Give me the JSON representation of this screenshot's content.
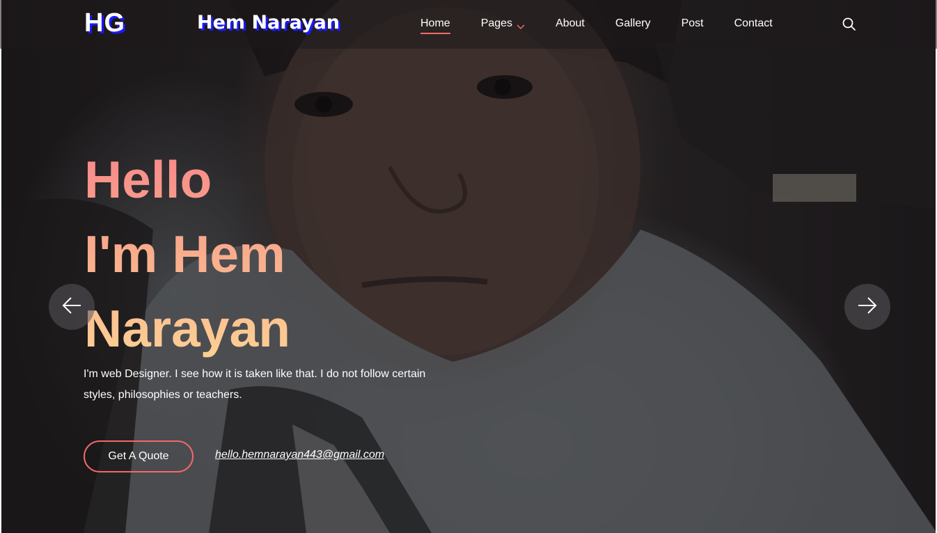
{
  "header": {
    "logo": "HG",
    "brand_name": "Hem Narayan",
    "nav": [
      {
        "label": "Home",
        "active": true
      },
      {
        "label": "Pages",
        "has_dropdown": true
      },
      {
        "label": "About"
      },
      {
        "label": "Gallery"
      },
      {
        "label": "Post"
      },
      {
        "label": "Contact"
      }
    ],
    "search_icon": "search-icon"
  },
  "hero": {
    "title_lines": [
      "Hello",
      "I'm Hem",
      "Narayan"
    ],
    "description": "I'm web Designer. I see how it is taken like that. I do not follow certain styles, philosophies or teachers.",
    "quote_button": "Get A Quote",
    "email": "hello.hemnarayan443@gmail.com",
    "prev_icon": "arrow-left-icon",
    "next_icon": "arrow-right-icon"
  },
  "colors": {
    "accent": "#f36a6a",
    "logo_shadow": "#1a1aff",
    "title_gradient_top": "#f7868a",
    "title_gradient_bottom": "#fcd394"
  }
}
